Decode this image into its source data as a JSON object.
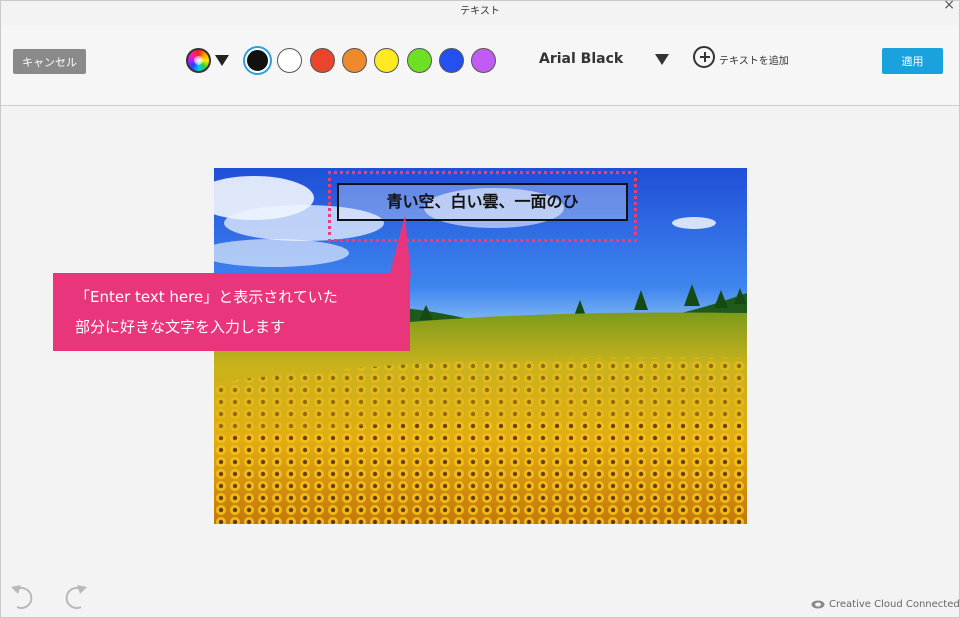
{
  "window": {
    "title": "テキスト"
  },
  "toolbar": {
    "cancel_label": "キャンセル",
    "apply_label": "適用",
    "font_name": "Arial Black",
    "add_text_label": "テキストを追加",
    "color_wheel_icon": "color-wheel-icon",
    "swatches": [
      "#111111",
      "#ffffff",
      "#e8452c",
      "#ef8a2c",
      "#ffea22",
      "#6ee024",
      "#2450f0",
      "#c05cf4"
    ],
    "selected_swatch": 0
  },
  "canvas": {
    "text_content": "青い空、白い雲、一面のひ"
  },
  "annotation": {
    "line1": "「Enter text here」と表示されていた",
    "line2": "部分に好きな文字を入力します",
    "color": "#e8357b"
  },
  "footer": {
    "undo_icon": "undo-icon",
    "redo_icon": "redo-icon",
    "status": "Creative Cloud Connected"
  }
}
